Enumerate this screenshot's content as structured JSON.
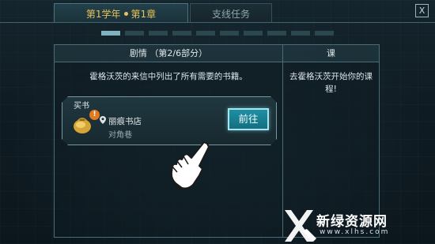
{
  "tabs": {
    "main": {
      "part1": "第1学年",
      "part2": "第1章"
    },
    "side": "支线任务"
  },
  "close_label": "X",
  "progress": {
    "total": 10,
    "current": 1
  },
  "panel": {
    "header": "剧情 （第2/6部分）",
    "description": "霍格沃茨的来信中列出了所有需要的书籍。"
  },
  "side_panel": {
    "header": "课",
    "text": "去霍格沃茨开始你的课程!"
  },
  "task": {
    "title": "买书",
    "badge": "!",
    "place": "丽痕书店",
    "sub": "对角巷",
    "button": "前往"
  },
  "watermark": {
    "name": "新绿资源网",
    "url": "www.xlhs.com"
  },
  "colors": {
    "accent_gold": "#e8c35a",
    "button_teal": "#1f8fa3",
    "badge_orange": "#e07a21"
  }
}
